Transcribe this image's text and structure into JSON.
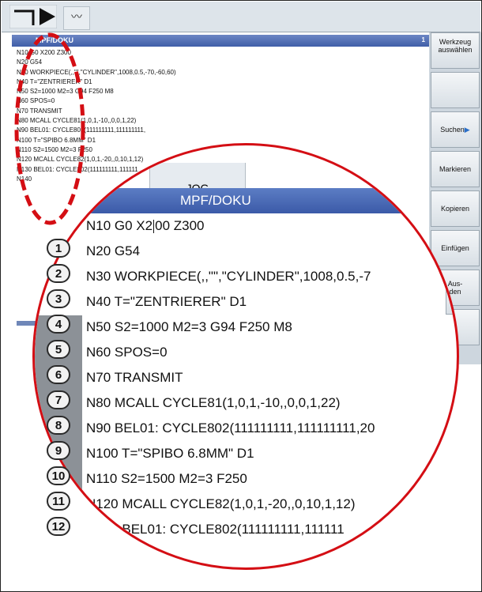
{
  "title": "MPF/DOKU",
  "line_count": "1",
  "mode": "JOG",
  "program_lines": [
    "N10 G0 X200 Z300",
    "N20 G54",
    "N30 WORKPIECE(,,\"\",\"CYLINDER\",1008,0.5,-70,-60,60)",
    "N40 T=\"ZENTRIERER\" D1",
    "N50 S2=1000 M2=3 G94 F250 M8",
    "N60 SPOS=0",
    "N70 TRANSMIT",
    "N80 MCALL CYCLE81(1,0,1,-10,,0,0,1,22)",
    "N90 BEL01: CYCLE802(111111111,111111111,",
    "N100 T=\"SPIBO 6.8MM\" D1",
    "N110 S2=1500 M2=3 F250",
    "N120 MCALL CYCLE82(1,0,1,-20,,0,10,1,12)",
    "N130 BEL01: CYCLE802(111111111,111111",
    "N140"
  ],
  "zoom_lines": [
    {
      "pre": "N10 G0 X2",
      "post": "00 Z300"
    },
    {
      "text": "N20 G54"
    },
    {
      "text": "N30 WORKPIECE(,,\"\",\"CYLINDER\",1008,0.5,-7"
    },
    {
      "text": "N40 T=\"ZENTRIERER\" D1"
    },
    {
      "text": "N50 S2=1000 M2=3 G94 F250 M8"
    },
    {
      "text": "N60 SPOS=0"
    },
    {
      "text": "N70 TRANSMIT"
    },
    {
      "text": "N80 MCALL CYCLE81(1,0,1,-10,,0,0,1,22)"
    },
    {
      "text": "N90 BEL01: CYCLE802(111111111,111111111,20"
    },
    {
      "text": "N100 T=\"SPIBO 6.8MM\" D1"
    },
    {
      "text": "N110 S2=1500 M2=3 F250"
    },
    {
      "text": "N120 MCALL CYCLE82(1,0,1,-20,,0,10,1,12)"
    },
    {
      "text": "N130 BEL01: CYCLE802(111111111,111111"
    },
    {
      "text": "N140"
    }
  ],
  "softkeys": {
    "werkzeug_1": "Werkzeug",
    "werkzeug_2": "auswählen",
    "suchen": "Suchen",
    "markieren": "Markieren",
    "kopieren": "Kopieren",
    "einfuegen": "Einfügen",
    "aus_1": "Aus-",
    "aus_2": "den"
  },
  "badges": [
    "1",
    "2",
    "3",
    "4",
    "5",
    "6",
    "7",
    "8",
    "9",
    "10",
    "11",
    "12"
  ],
  "colors": {
    "header_blue": "#3f5ea8",
    "highlight_red": "#d40e14",
    "softkey_arrow": "#2a6fc9"
  },
  "icons": {
    "mode": "mode-switch-icon",
    "wave": "wave-icon",
    "softkey_arrow": "chevron-right-icon"
  }
}
